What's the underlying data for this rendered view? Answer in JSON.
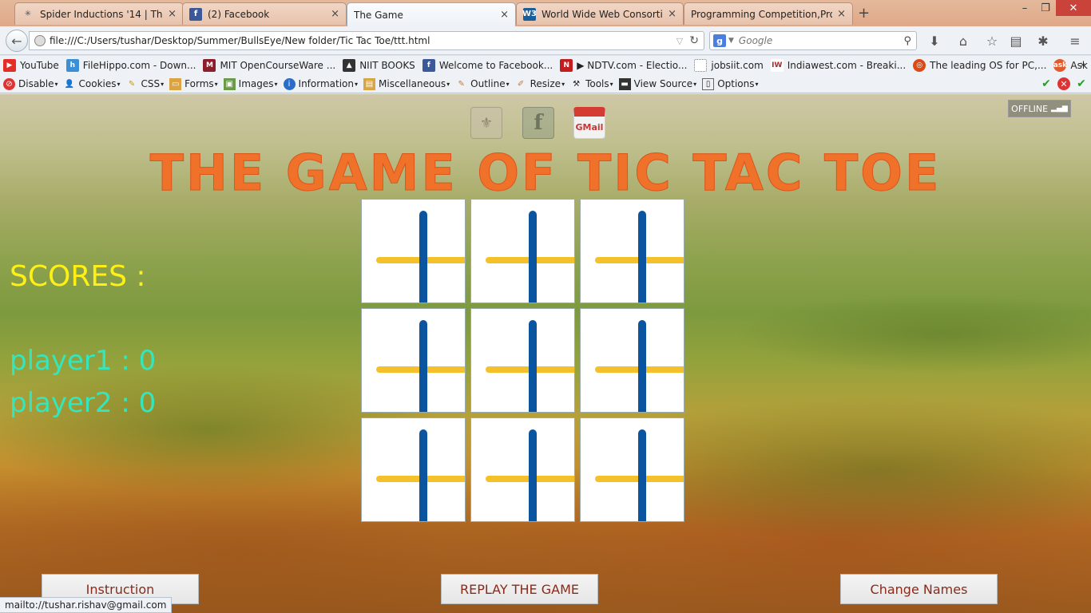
{
  "browser": {
    "tabs": [
      {
        "title": "Spider Inductions '14 | The ...",
        "icon": "spider-icon",
        "active": false
      },
      {
        "title": "(2) Facebook",
        "icon": "facebook-icon",
        "active": false
      },
      {
        "title": "The Game",
        "icon": "",
        "active": true
      },
      {
        "title": "World Wide Web Consorti...",
        "icon": "w3c-icon",
        "active": false
      },
      {
        "title": "Programming Competition,Pro...",
        "icon": "",
        "active": false
      }
    ],
    "url": "file:///C:/Users/tushar/Desktop/Summer/BullsEye/New folder/Tic Tac Toe/ttt.html",
    "search_placeholder": "Google",
    "bookmarks": [
      {
        "label": "YouTube",
        "icon": "youtube-icon",
        "color": "#e52d27"
      },
      {
        "label": "FileHippo.com - Down...",
        "icon": "filehippo-icon",
        "color": "#3a8fd6"
      },
      {
        "label": "MIT OpenCourseWare ...",
        "icon": "mit-icon",
        "color": "#8a1f2b"
      },
      {
        "label": "NIIT BOOKS",
        "icon": "linux-penguin-icon",
        "color": "#333333"
      },
      {
        "label": "Welcome to Facebook...",
        "icon": "facebook-icon",
        "color": "#3b5998"
      },
      {
        "label": "▶ NDTV.com - Electio...",
        "icon": "ndtv-icon",
        "color": "#c21e1e"
      },
      {
        "label": "jobsiit.com",
        "icon": "blank-page-icon",
        "color": "#ffffff"
      },
      {
        "label": "Indiawest.com - Breaki...",
        "icon": "iw-icon",
        "color": "#ffffff"
      },
      {
        "label": "The leading OS for PC,...",
        "icon": "ubuntu-icon",
        "color": "#dd4814"
      },
      {
        "label": "Ask Ubuntu",
        "icon": "ask-icon",
        "color": "#e15a2e"
      }
    ],
    "devbar": [
      {
        "label": "Disable",
        "icon": "disable-icon"
      },
      {
        "label": "Cookies",
        "icon": "cookies-icon"
      },
      {
        "label": "CSS",
        "icon": "css-icon"
      },
      {
        "label": "Forms",
        "icon": "forms-icon"
      },
      {
        "label": "Images",
        "icon": "images-icon"
      },
      {
        "label": "Information",
        "icon": "information-icon"
      },
      {
        "label": "Miscellaneous",
        "icon": "miscellaneous-icon"
      },
      {
        "label": "Outline",
        "icon": "outline-icon"
      },
      {
        "label": "Resize",
        "icon": "resize-icon"
      },
      {
        "label": "Tools",
        "icon": "tools-icon"
      },
      {
        "label": "View Source",
        "icon": "view-source-icon"
      },
      {
        "label": "Options",
        "icon": "options-icon"
      }
    ],
    "status_text": "mailto://tushar.rishav@gmail.com"
  },
  "page": {
    "offline_label": "OFFLINE",
    "gmail_label": "GMail",
    "facebook_label": "f",
    "title": "THE GAME OF TIC TAC TOE",
    "scores_label": "SCORES :",
    "players": [
      {
        "text": "player1 : 0"
      },
      {
        "text": "player2 : 0"
      }
    ],
    "buttons": {
      "instruction": "Instruction",
      "replay": "REPLAY THE GAME",
      "change_names": "Change Names"
    },
    "colors": {
      "title": "#f0712a",
      "scores": "#ffef14",
      "players": "#35e6bd",
      "cell_vertical": "#0b55a0",
      "cell_horizontal": "#f4c12b"
    }
  }
}
